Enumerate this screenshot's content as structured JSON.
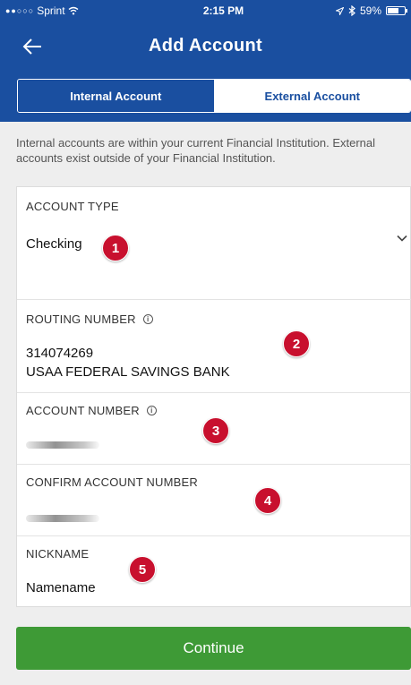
{
  "status_bar": {
    "carrier": "Sprint",
    "time": "2:15 PM",
    "battery": "59%"
  },
  "header": {
    "title": "Add Account"
  },
  "tabs": [
    {
      "label": "Internal Account"
    },
    {
      "label": "External Account"
    }
  ],
  "info_text": "Internal accounts are within your current Financial Institution. External accounts exist outside of your Financial Institution.",
  "form": {
    "account_type": {
      "label": "ACCOUNT TYPE",
      "value": "Checking"
    },
    "routing_number": {
      "label": "ROUTING NUMBER",
      "value": "314074269",
      "bank_name": "USAA FEDERAL SAVINGS BANK"
    },
    "account_number": {
      "label": "ACCOUNT NUMBER"
    },
    "confirm_account_number": {
      "label": "CONFIRM ACCOUNT NUMBER"
    },
    "nickname": {
      "label": "NICKNAME",
      "value": "Namename"
    }
  },
  "badges": [
    "1",
    "2",
    "3",
    "4",
    "5"
  ],
  "continue_label": "Continue",
  "colors": {
    "header_blue": "#1a4fa0",
    "continue_green": "#3e9a36",
    "badge_red": "#c8102e"
  }
}
